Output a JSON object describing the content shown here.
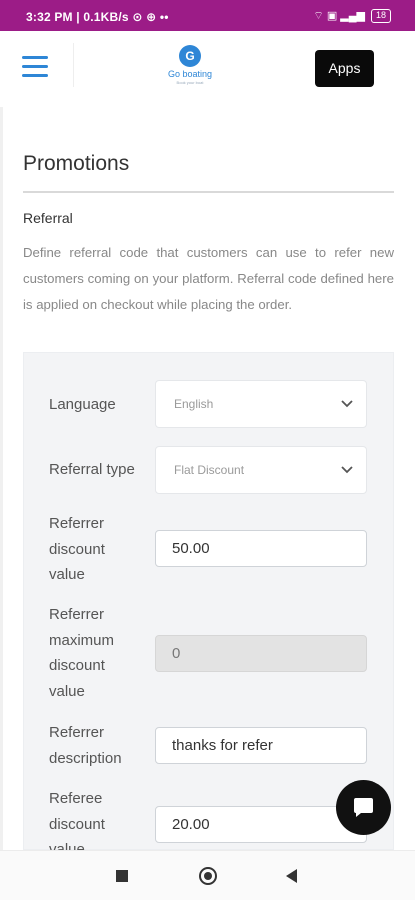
{
  "status_bar": {
    "left": "3:32 PM | 0.1KB/s ⊙ ⊕ ••",
    "right_icons": "⌔ ▣ ▂▄▆",
    "battery": "18"
  },
  "header": {
    "logo_letter": "G",
    "logo_text": "Go boating",
    "logo_sub": "Book your boat",
    "apps_label": "Apps"
  },
  "page": {
    "title": "Promotions",
    "section_title": "Referral",
    "section_desc": "Define referral code that customers can use to refer new customers coming on your platform. Referral code defined here is applied on checkout while placing the order."
  },
  "form": {
    "language_label": "Language",
    "language_value": "English",
    "referral_type_label": "Referral type",
    "referral_type_value": "Flat Discount",
    "referrer_discount_label": "Referrer discount value",
    "referrer_discount_value": "50.00",
    "referrer_max_label": "Referrer maximum discount value",
    "referrer_max_value": "0",
    "referrer_desc_label": "Referrer description",
    "referrer_desc_value": "thanks for refer",
    "referee_discount_label": "Referee discount value",
    "referee_discount_value": "20.00"
  },
  "icons": {
    "menu": "hamburger-menu-icon",
    "chevron": "chevron-down-icon",
    "chat": "chat-bubble-icon",
    "nav_recent": "stop-square-icon",
    "nav_home": "home-circle-icon",
    "nav_back": "back-triangle-icon"
  },
  "colors": {
    "status_bar": "#9c1c87",
    "accent": "#2e86d6",
    "apps_button": "#0a0a0a"
  }
}
